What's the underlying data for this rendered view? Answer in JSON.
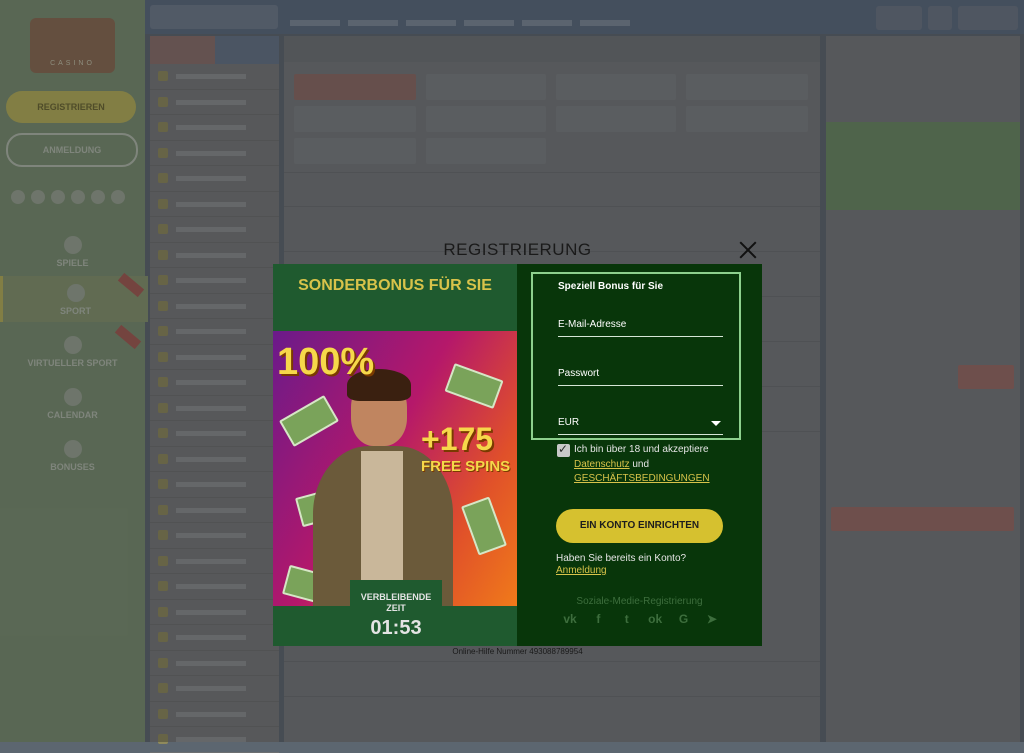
{
  "background": {
    "sidebar": {
      "logo_text": "CASINO",
      "register_label": "REGISTRIEREN",
      "login_label": "ANMELDUNG",
      "nav_items": [
        {
          "label": "SPIELE"
        },
        {
          "label": "SPORT"
        },
        {
          "label": "VIRTUELLER SPORT"
        },
        {
          "label": "CALENDAR"
        },
        {
          "label": "BONUSES"
        }
      ]
    }
  },
  "modal": {
    "title": "REGISTRIERUNG",
    "promo": {
      "headline": "SONDERBONUS FÜR SIE",
      "percent": "100%",
      "spins_count": "+175",
      "spins_label": "FREE SPINS",
      "timer_label": "VERBLEIBENDE ZEIT",
      "timer_value": "01:53"
    },
    "form": {
      "heading": "Speziell Bonus für Sie",
      "email_placeholder": "E-Mail-Adresse",
      "password_placeholder": "Passwort",
      "currency_value": "EUR",
      "consent_text": "Ich bin über 18 und akzeptiere",
      "privacy_link": "Datenschutz",
      "and_text": "und",
      "terms_link": "GESCHÄFTSBEDINGUNGEN",
      "submit_label": "EIN KONTO EINRICHTEN",
      "have_account_text": "Haben Sie bereits ein Konto?",
      "login_link": "Anmeldung",
      "social_title": "Soziale-Medie-Registrierung",
      "social_icons": [
        "vk-icon",
        "facebook-icon",
        "twitter-icon",
        "odnoklassniki-icon",
        "google-icon",
        "telegram-icon"
      ]
    },
    "helpline": "Online-Hilfe Nummer 493088789954"
  },
  "colors": {
    "promo_green": "#1f5a2f",
    "form_green": "#08360a",
    "accent_yellow": "#d6c12f",
    "link_yellow": "#d8c34a"
  }
}
